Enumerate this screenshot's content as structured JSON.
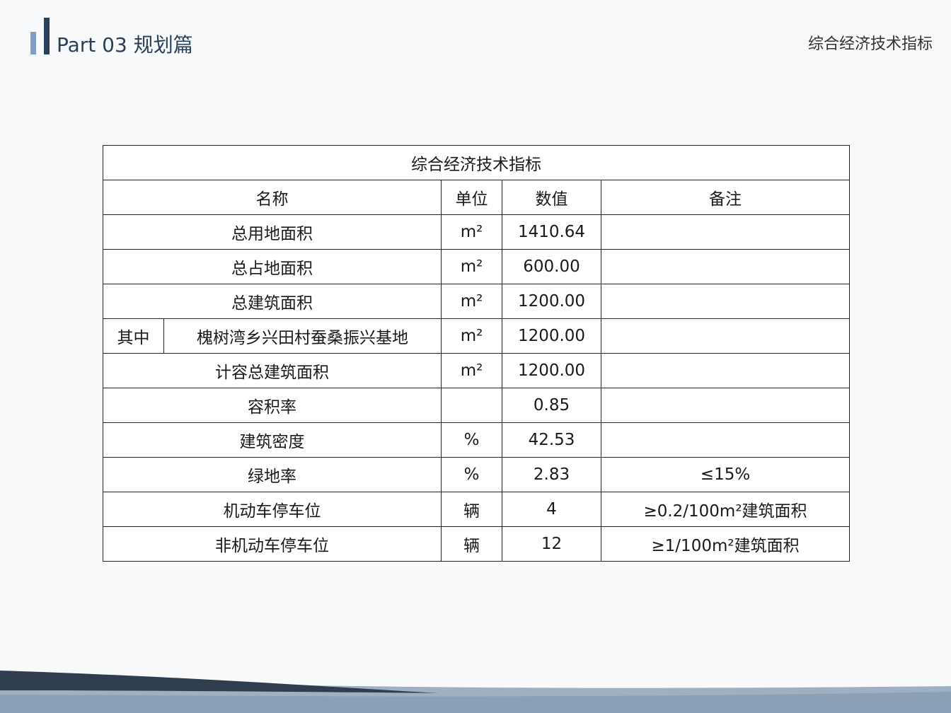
{
  "header": {
    "part_title": "Part 03  规划篇",
    "page_subtitle": "综合经济技术指标"
  },
  "table": {
    "title": "综合经济技术指标",
    "columns": [
      "名称",
      "单位",
      "数值",
      "备注"
    ],
    "rows": [
      {
        "name": "总用地面积",
        "unit": "m²",
        "value": "1410.64",
        "note": ""
      },
      {
        "name": "总占地面积",
        "unit": "m²",
        "value": "600.00",
        "note": ""
      },
      {
        "name": "总建筑面积",
        "unit": "m²",
        "value": "1200.00",
        "note": ""
      },
      {
        "group": "其中",
        "name": "槐树湾乡兴田村蚕桑振兴基地",
        "unit": "m²",
        "value": "1200.00",
        "note": ""
      },
      {
        "name": "计容总建筑面积",
        "unit": "m²",
        "value": "1200.00",
        "note": ""
      },
      {
        "name": "容积率",
        "unit": "",
        "value": "0.85",
        "note": ""
      },
      {
        "name": "建筑密度",
        "unit": "%",
        "value": "42.53",
        "note": ""
      },
      {
        "name": "绿地率",
        "unit": "%",
        "value": "2.83",
        "note": "≤15%"
      },
      {
        "name": "机动车停车位",
        "unit": "辆",
        "value": "4",
        "note": "≥0.2/100m²建筑面积"
      },
      {
        "name": "非机动车停车位",
        "unit": "辆",
        "value": "12",
        "note": "≥1/100m²建筑面积"
      }
    ]
  },
  "colors": {
    "accent_dark": "#2b3f5a",
    "accent_light": "#7f9fc6"
  }
}
